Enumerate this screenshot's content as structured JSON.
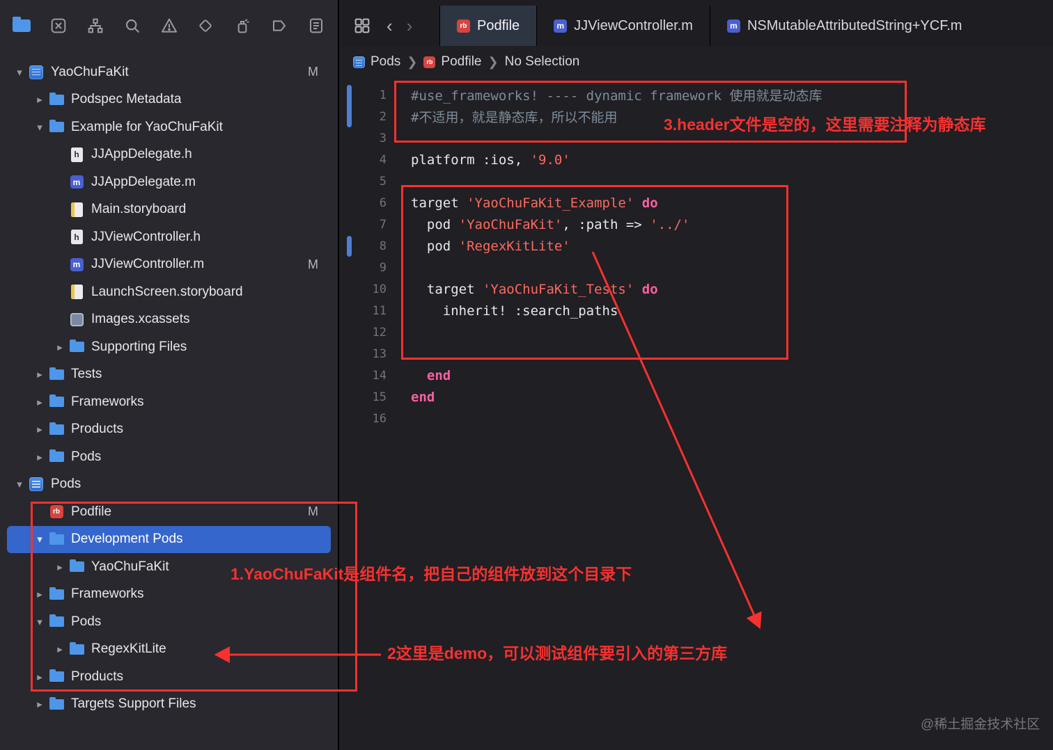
{
  "colors": {
    "accent": "#3566cc",
    "annotation_red": "#f8312f",
    "string": "#fc6a5d",
    "keyword": "#fc5fa3",
    "comment": "#7f8c98"
  },
  "navigator_toolbar": {
    "icons": [
      "project-navigator",
      "source-control-navigator",
      "symbol-navigator",
      "find-navigator",
      "issue-navigator",
      "test-navigator",
      "debug-navigator",
      "breakpoint-navigator",
      "report-navigator"
    ]
  },
  "sidebar": {
    "items": [
      {
        "label": "YaoChuFaKit",
        "level": 0,
        "icon": "app",
        "disclosure": "down",
        "badge": "M",
        "selected": false
      },
      {
        "label": "Podspec Metadata",
        "level": 1,
        "icon": "folder",
        "disclosure": "right",
        "badge": "",
        "selected": false
      },
      {
        "label": "Example for YaoChuFaKit",
        "level": 1,
        "icon": "folder",
        "disclosure": "down",
        "badge": "",
        "selected": false
      },
      {
        "label": "JJAppDelegate.h",
        "level": 2,
        "icon": "h",
        "disclosure": "",
        "badge": "",
        "selected": false
      },
      {
        "label": "JJAppDelegate.m",
        "level": 2,
        "icon": "m",
        "disclosure": "",
        "badge": "",
        "selected": false
      },
      {
        "label": "Main.storyboard",
        "level": 2,
        "icon": "storyboard",
        "disclosure": "",
        "badge": "",
        "selected": false
      },
      {
        "label": "JJViewController.h",
        "level": 2,
        "icon": "h",
        "disclosure": "",
        "badge": "",
        "selected": false
      },
      {
        "label": "JJViewController.m",
        "level": 2,
        "icon": "m",
        "disclosure": "",
        "badge": "M",
        "selected": false
      },
      {
        "label": "LaunchScreen.storyboard",
        "level": 2,
        "icon": "storyboard",
        "disclosure": "",
        "badge": "",
        "selected": false
      },
      {
        "label": "Images.xcassets",
        "level": 2,
        "icon": "xcassets",
        "disclosure": "",
        "badge": "",
        "selected": false
      },
      {
        "label": "Supporting Files",
        "level": 2,
        "icon": "folder",
        "disclosure": "right",
        "badge": "",
        "selected": false
      },
      {
        "label": "Tests",
        "level": 1,
        "icon": "folder",
        "disclosure": "right",
        "badge": "",
        "selected": false
      },
      {
        "label": "Frameworks",
        "level": 1,
        "icon": "folder",
        "disclosure": "right",
        "badge": "",
        "selected": false
      },
      {
        "label": "Products",
        "level": 1,
        "icon": "folder",
        "disclosure": "right",
        "badge": "",
        "selected": false
      },
      {
        "label": "Pods",
        "level": 1,
        "icon": "folder",
        "disclosure": "right",
        "badge": "",
        "selected": false
      },
      {
        "label": "Pods",
        "level": 0,
        "icon": "app",
        "disclosure": "down",
        "badge": "",
        "selected": false
      },
      {
        "label": "Podfile",
        "level": 1,
        "icon": "rb",
        "disclosure": "",
        "badge": "M",
        "selected": false
      },
      {
        "label": "Development Pods",
        "level": 1,
        "icon": "folder",
        "disclosure": "down",
        "badge": "",
        "selected": true
      },
      {
        "label": "YaoChuFaKit",
        "level": 2,
        "icon": "folder",
        "disclosure": "right",
        "badge": "",
        "selected": false
      },
      {
        "label": "Frameworks",
        "level": 1,
        "icon": "folder",
        "disclosure": "right",
        "badge": "",
        "selected": false
      },
      {
        "label": "Pods",
        "level": 1,
        "icon": "folder",
        "disclosure": "down",
        "badge": "",
        "selected": false
      },
      {
        "label": "RegexKitLite",
        "level": 2,
        "icon": "folder",
        "disclosure": "right",
        "badge": "",
        "selected": false
      },
      {
        "label": "Products",
        "level": 1,
        "icon": "folder",
        "disclosure": "right",
        "badge": "",
        "selected": false
      },
      {
        "label": "Targets Support Files",
        "level": 1,
        "icon": "folder",
        "disclosure": "right",
        "badge": "",
        "selected": false
      }
    ]
  },
  "tab_bar": {
    "tabs": [
      {
        "label": "Podfile",
        "icon": "rb",
        "icon_label": "rb",
        "active": true
      },
      {
        "label": "JJViewController.m",
        "icon": "m",
        "icon_label": "m",
        "active": false
      },
      {
        "label": "NSMutableAttributedString+YCF.m",
        "icon": "m",
        "icon_label": "m",
        "active": false
      }
    ]
  },
  "breadcrumb": {
    "items": [
      {
        "label": "Pods",
        "icon": "app"
      },
      {
        "label": "Podfile",
        "icon": "rb"
      },
      {
        "label": "No Selection",
        "icon": ""
      }
    ]
  },
  "editor": {
    "lines": [
      {
        "num": "1",
        "segments": [
          {
            "t": "#use_frameworks! ---- dynamic framework 使用就是动态库",
            "s": "comment"
          }
        ]
      },
      {
        "num": "2",
        "segments": [
          {
            "t": "#不适用，就是静态库，所以不能用",
            "s": "comment"
          }
        ]
      },
      {
        "num": "3",
        "segments": []
      },
      {
        "num": "4",
        "segments": [
          {
            "t": "platform :ios, ",
            "s": "plain"
          },
          {
            "t": "'9.0'",
            "s": "string"
          }
        ]
      },
      {
        "num": "5",
        "segments": []
      },
      {
        "num": "6",
        "segments": [
          {
            "t": "target ",
            "s": "plain"
          },
          {
            "t": "'YaoChuFaKit_Example'",
            "s": "string"
          },
          {
            "t": " ",
            "s": "plain"
          },
          {
            "t": "do",
            "s": "keyword"
          }
        ]
      },
      {
        "num": "7",
        "segments": [
          {
            "t": "  pod ",
            "s": "plain"
          },
          {
            "t": "'YaoChuFaKit'",
            "s": "string"
          },
          {
            "t": ", :path => ",
            "s": "plain"
          },
          {
            "t": "'../'",
            "s": "string"
          }
        ]
      },
      {
        "num": "8",
        "segments": [
          {
            "t": "  pod ",
            "s": "plain"
          },
          {
            "t": "'RegexKitLite'",
            "s": "string"
          }
        ]
      },
      {
        "num": "9",
        "segments": []
      },
      {
        "num": "10",
        "segments": [
          {
            "t": "  target ",
            "s": "plain"
          },
          {
            "t": "'YaoChuFaKit_Tests'",
            "s": "string"
          },
          {
            "t": " ",
            "s": "plain"
          },
          {
            "t": "do",
            "s": "keyword"
          }
        ]
      },
      {
        "num": "11",
        "segments": [
          {
            "t": "    inherit! :search_paths",
            "s": "plain"
          }
        ]
      },
      {
        "num": "12",
        "segments": []
      },
      {
        "num": "13",
        "segments": []
      },
      {
        "num": "14",
        "segments": [
          {
            "t": "  ",
            "s": "plain"
          },
          {
            "t": "end",
            "s": "keyword"
          }
        ]
      },
      {
        "num": "15",
        "segments": [
          {
            "t": "end",
            "s": "keyword"
          }
        ]
      },
      {
        "num": "16",
        "segments": []
      }
    ]
  },
  "annotations": {
    "note1": "1.YaoChuFaKit是组件名，把自己的组件放到这个目录下",
    "note2": "2这里是demo，可以测试组件要引入的第三方库",
    "note3": "3.header文件是空的，这里需要注释为静态库"
  },
  "watermark": "@稀土掘金技术社区"
}
